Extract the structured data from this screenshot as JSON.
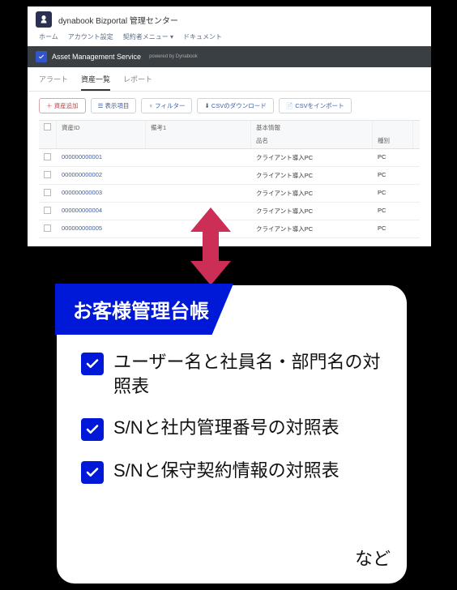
{
  "app": {
    "title": "dynabook Bizportal 管理センター",
    "nav": [
      "ホーム",
      "アカウント設定",
      "契約者メニュー ▾",
      "ドキュメント"
    ],
    "dark_bar": {
      "title": "Asset Management Service",
      "powered": "powered by Dynabook"
    }
  },
  "tabs": {
    "t0": "アラート",
    "t1": "資産一覧",
    "t2": "レポート"
  },
  "toolbar": {
    "add": "＋ 資産追加",
    "columns": "☰ 表示項目",
    "filter": "♀ フィルター",
    "download": "⬇ CSVのダウンロード",
    "import": "📄 CSVをインポート"
  },
  "table": {
    "headers": {
      "id": "資産ID",
      "remark": "備考1",
      "basic": "基本情報",
      "name": "品名",
      "type": "種別"
    },
    "rows": [
      {
        "id": "000000000001",
        "remark": "",
        "name": "クライアント導入PC",
        "type": "PC"
      },
      {
        "id": "000000000002",
        "remark": "",
        "name": "クライアント導入PC",
        "type": "PC"
      },
      {
        "id": "000000000003",
        "remark": "",
        "name": "クライアント導入PC",
        "type": "PC"
      },
      {
        "id": "000000000004",
        "remark": "",
        "name": "クライアント導入PC",
        "type": "PC"
      },
      {
        "id": "000000000005",
        "remark": "",
        "name": "クライアント導入PC",
        "type": "PC"
      }
    ]
  },
  "ledger": {
    "title": "お客様管理台帳",
    "items": [
      "ユーザー名と社員名・部門名の対照表",
      "S/Nと社内管理番号の対照表",
      "S/Nと保守契約情報の対照表"
    ],
    "etc": "など"
  }
}
